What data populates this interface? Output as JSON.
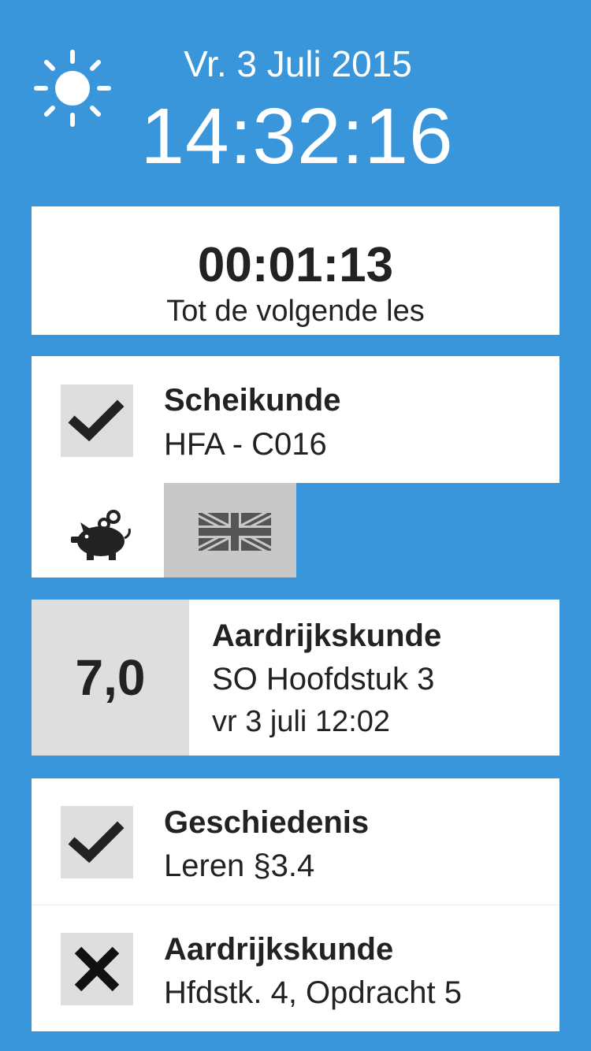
{
  "header": {
    "weather_icon": "sun-icon",
    "date": "Vr. 3 Juli 2015",
    "time": "14:32:16"
  },
  "countdown": {
    "value": "00:01:13",
    "label": "Tot de volgende les"
  },
  "next_lesson": {
    "status_icon": "checkmark-icon",
    "subject": "Scheikunde",
    "location": "HFA - C016",
    "badges": [
      "piggy-bank-icon",
      "uk-flag-icon"
    ]
  },
  "grade": {
    "value": "7,0",
    "subject": "Aardrijkskunde",
    "description": "SO Hoofdstuk 3",
    "datetime": "vr 3 juli 12:02"
  },
  "homework": [
    {
      "status_icon": "checkmark-icon",
      "subject": "Geschiedenis",
      "task": "Leren §3.4"
    },
    {
      "status_icon": "cross-icon",
      "subject": "Aardrijkskunde",
      "task": "Hfdstk. 4, Opdracht 5"
    }
  ],
  "colors": {
    "background": "#3a96da",
    "card": "#ffffff",
    "tile": "#dedede",
    "flag_tile": "#c8c8c8",
    "text": "#222222"
  }
}
